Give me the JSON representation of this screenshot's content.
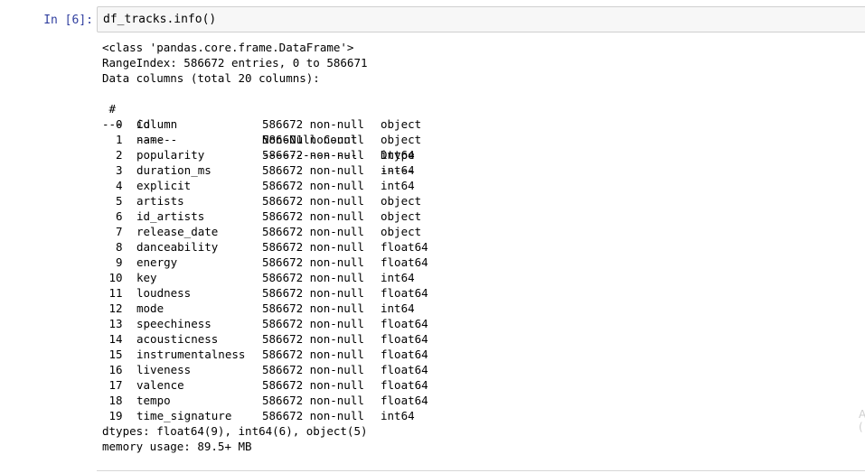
{
  "cell": {
    "prompt": "In [6]:",
    "code": "df_tracks.info()"
  },
  "output": {
    "class_line": "<class 'pandas.core.frame.DataFrame'>",
    "range_index": "RangeIndex: 586672 entries, 0 to 586671",
    "data_columns": "Data columns (total 20 columns):",
    "headers": {
      "num": " #",
      "column": "Column",
      "non_null": "Non-Null Count",
      "dtype": "Dtype"
    },
    "separators": {
      "num": "---",
      "column": "------",
      "non_null": "--------------",
      "dtype": "-----"
    },
    "rows": [
      {
        "num": "0",
        "column": "id",
        "non_null": "586672 non-null",
        "dtype": "object"
      },
      {
        "num": "1",
        "column": "name",
        "non_null": "586601 non-null",
        "dtype": "object"
      },
      {
        "num": "2",
        "column": "popularity",
        "non_null": "586672 non-null",
        "dtype": "int64"
      },
      {
        "num": "3",
        "column": "duration_ms",
        "non_null": "586672 non-null",
        "dtype": "int64"
      },
      {
        "num": "4",
        "column": "explicit",
        "non_null": "586672 non-null",
        "dtype": "int64"
      },
      {
        "num": "5",
        "column": "artists",
        "non_null": "586672 non-null",
        "dtype": "object"
      },
      {
        "num": "6",
        "column": "id_artists",
        "non_null": "586672 non-null",
        "dtype": "object"
      },
      {
        "num": "7",
        "column": "release_date",
        "non_null": "586672 non-null",
        "dtype": "object"
      },
      {
        "num": "8",
        "column": "danceability",
        "non_null": "586672 non-null",
        "dtype": "float64"
      },
      {
        "num": "9",
        "column": "energy",
        "non_null": "586672 non-null",
        "dtype": "float64"
      },
      {
        "num": "10",
        "column": "key",
        "non_null": "586672 non-null",
        "dtype": "int64"
      },
      {
        "num": "11",
        "column": "loudness",
        "non_null": "586672 non-null",
        "dtype": "float64"
      },
      {
        "num": "12",
        "column": "mode",
        "non_null": "586672 non-null",
        "dtype": "int64"
      },
      {
        "num": "13",
        "column": "speechiness",
        "non_null": "586672 non-null",
        "dtype": "float64"
      },
      {
        "num": "14",
        "column": "acousticness",
        "non_null": "586672 non-null",
        "dtype": "float64"
      },
      {
        "num": "15",
        "column": "instrumentalness",
        "non_null": "586672 non-null",
        "dtype": "float64"
      },
      {
        "num": "16",
        "column": "liveness",
        "non_null": "586672 non-null",
        "dtype": "float64"
      },
      {
        "num": "17",
        "column": "valence",
        "non_null": "586672 non-null",
        "dtype": "float64"
      },
      {
        "num": "18",
        "column": "tempo",
        "non_null": "586672 non-null",
        "dtype": "float64"
      },
      {
        "num": "19",
        "column": "time_signature",
        "non_null": "586672 non-null",
        "dtype": "int64"
      }
    ],
    "dtypes_line": "dtypes: float64(9), int64(6), object(5)",
    "memory_line": "memory usage: 89.5+ MB"
  },
  "colors": {
    "prompt": "#303f9f",
    "input_bg": "#f7f7f7",
    "input_border": "#cfcfcf"
  }
}
